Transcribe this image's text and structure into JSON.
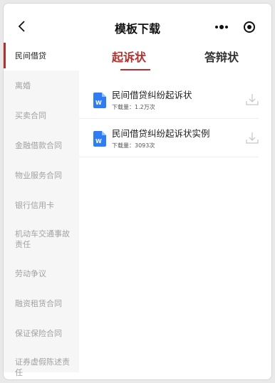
{
  "navbar": {
    "title": "模板下载",
    "back_icon": "chevron-left-icon",
    "more_icon": "more-dots-icon",
    "close_icon": "target-circle-icon"
  },
  "sidebar": {
    "items": [
      {
        "label": "民间借贷",
        "active": true
      },
      {
        "label": "离婚",
        "active": false
      },
      {
        "label": "买卖合同",
        "active": false
      },
      {
        "label": "金融借款合同",
        "active": false
      },
      {
        "label": "物业服务合同",
        "active": false
      },
      {
        "label": "银行信用卡",
        "active": false
      },
      {
        "label": "机动车交通事故责任",
        "active": false
      },
      {
        "label": "劳动争议",
        "active": false
      },
      {
        "label": "融资租赁合同",
        "active": false
      },
      {
        "label": "保证保险合同",
        "active": false
      },
      {
        "label": "证券虚假陈述责任",
        "active": false
      }
    ]
  },
  "tabs": [
    {
      "label": "起诉状",
      "active": true
    },
    {
      "label": "答辩状",
      "active": false
    }
  ],
  "files": [
    {
      "title": "民间借贷纠纷起诉状",
      "downloads": "下载量：1.2万次",
      "icon": "word-doc-icon",
      "action_icon": "download-icon"
    },
    {
      "title": "民间借贷纠纷起诉状实例",
      "downloads": "下载量：3093次",
      "icon": "word-doc-icon",
      "action_icon": "download-icon"
    }
  ],
  "colors": {
    "accent": "#b5302d",
    "sidebar_bg": "#f6f6f6",
    "word_blue": "#2f7df6"
  }
}
